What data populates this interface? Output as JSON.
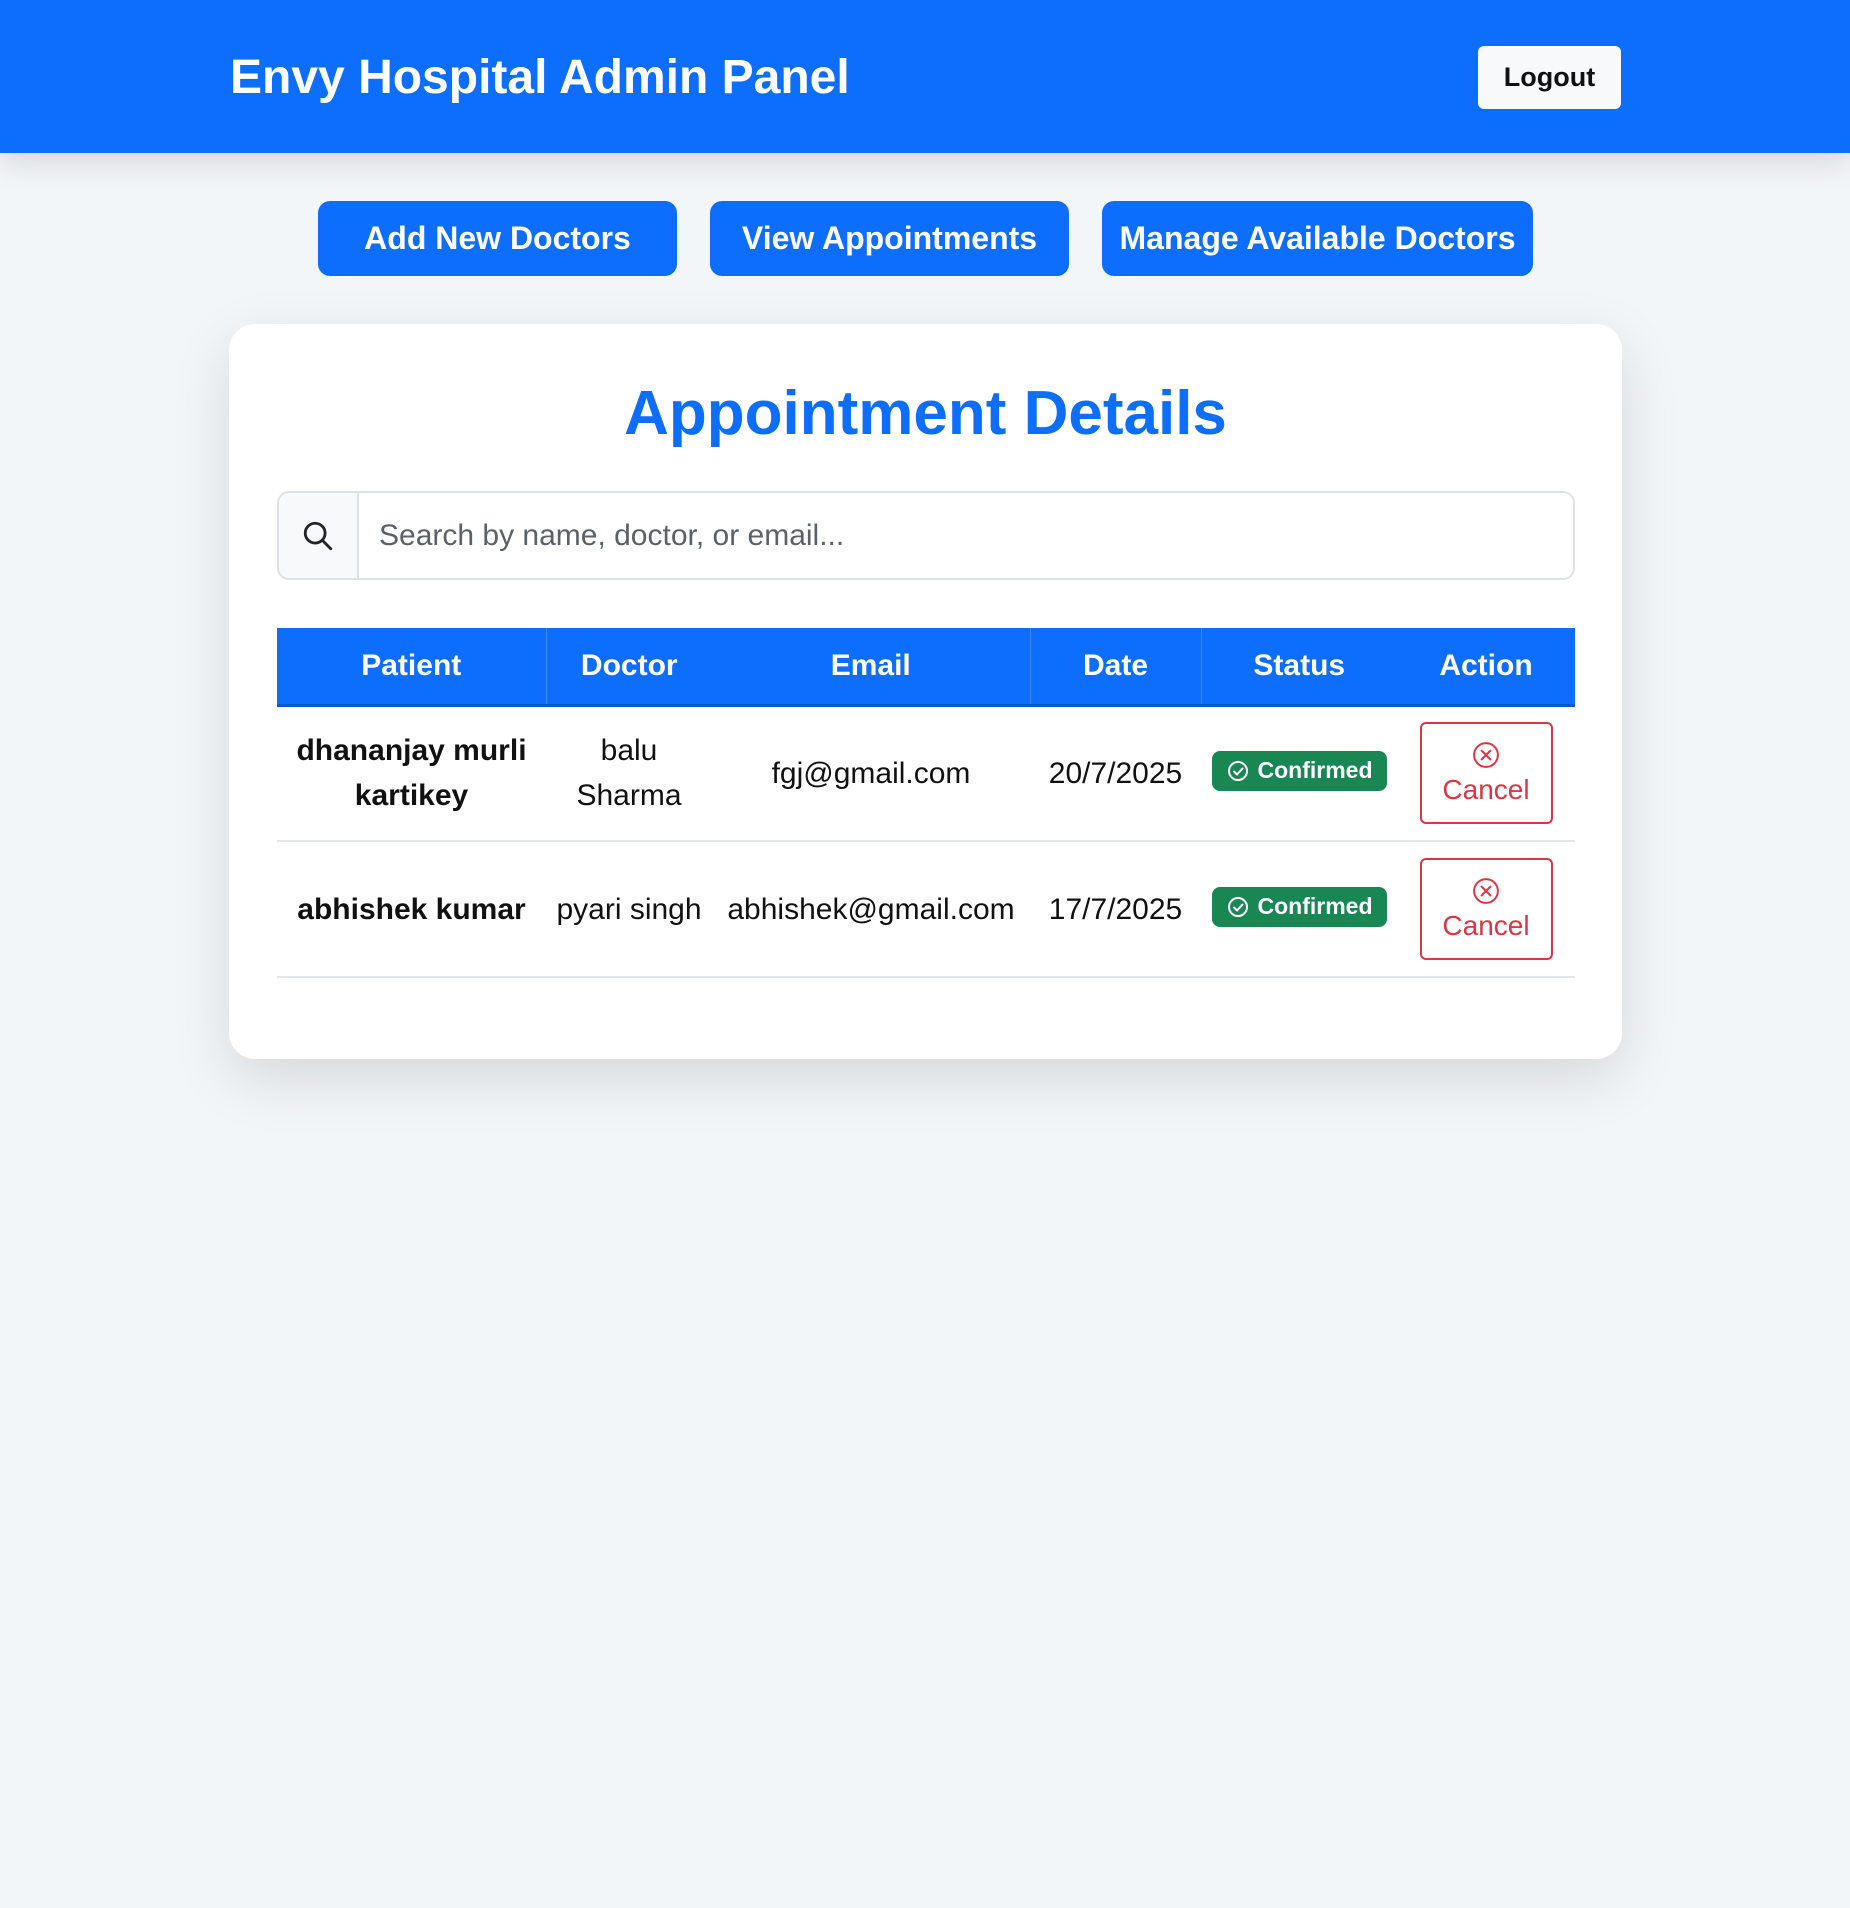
{
  "header": {
    "title": "Envy Hospital Admin Panel",
    "logout_label": "Logout"
  },
  "nav": {
    "add_doctors": "Add New Doctors",
    "view_appointments": "View Appointments",
    "manage_doctors": "Manage Available Doctors"
  },
  "card": {
    "title": "Appointment Details"
  },
  "search": {
    "placeholder": "Search by name, doctor, or email...",
    "icon": "search-icon"
  },
  "table": {
    "columns": [
      "Patient",
      "Doctor",
      "Email",
      "Date",
      "Status",
      "Action"
    ],
    "rows": [
      {
        "patient": "dhananjay murli kartikey",
        "doctor": "balu Sharma",
        "email": "fgj@gmail.com",
        "date": "20/7/2025",
        "status": "Confirmed",
        "action": "Cancel"
      },
      {
        "patient": "abhishek kumar",
        "doctor": "pyari singh",
        "email": "abhishek@gmail.com",
        "date": "17/7/2025",
        "status": "Confirmed",
        "action": "Cancel"
      }
    ]
  },
  "colors": {
    "primary": "#0d6efd",
    "success": "#198754",
    "danger": "#dc3545",
    "background": "#f3f6f9"
  }
}
